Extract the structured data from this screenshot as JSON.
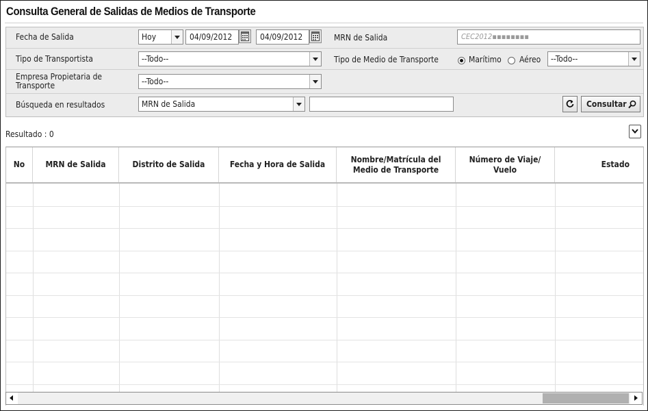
{
  "title": "Consulta General de Salidas de Medios de Transporte",
  "form": {
    "fecha_salida": {
      "label": "Fecha de Salida",
      "period": "Hoy",
      "from_date": "04/09/2012",
      "to_date": "04/09/2012"
    },
    "mrn_salida": {
      "label": "MRN de Salida",
      "placeholder": "CEC2012▪▪▪▪▪▪▪▪"
    },
    "tipo_transportista": {
      "label": "Tipo de Transportista",
      "value": "--Todo--"
    },
    "tipo_medio": {
      "label": "Tipo de Medio de Transporte",
      "options": [
        "Marítimo",
        "Aéreo"
      ],
      "selected": "Marítimo",
      "sub_value": "--Todo--"
    },
    "empresa": {
      "label": "Empresa Propietaria de Transporte",
      "value": "--Todo--"
    },
    "busqueda": {
      "label": "Búsqueda en resultados",
      "field": "MRN de Salida",
      "text": ""
    },
    "refresh_icon": "refresh-icon",
    "consultar_label": "Consultar"
  },
  "result": {
    "label": "Resultado : 0"
  },
  "table": {
    "columns": [
      "No",
      "MRN de Salida",
      "Distrito de Salida",
      "Fecha y Hora de Salida",
      "Nombre/Matrícula del Medio de Transporte",
      "Número de Viaje/ Vuelo",
      "Estado"
    ],
    "rows": []
  }
}
